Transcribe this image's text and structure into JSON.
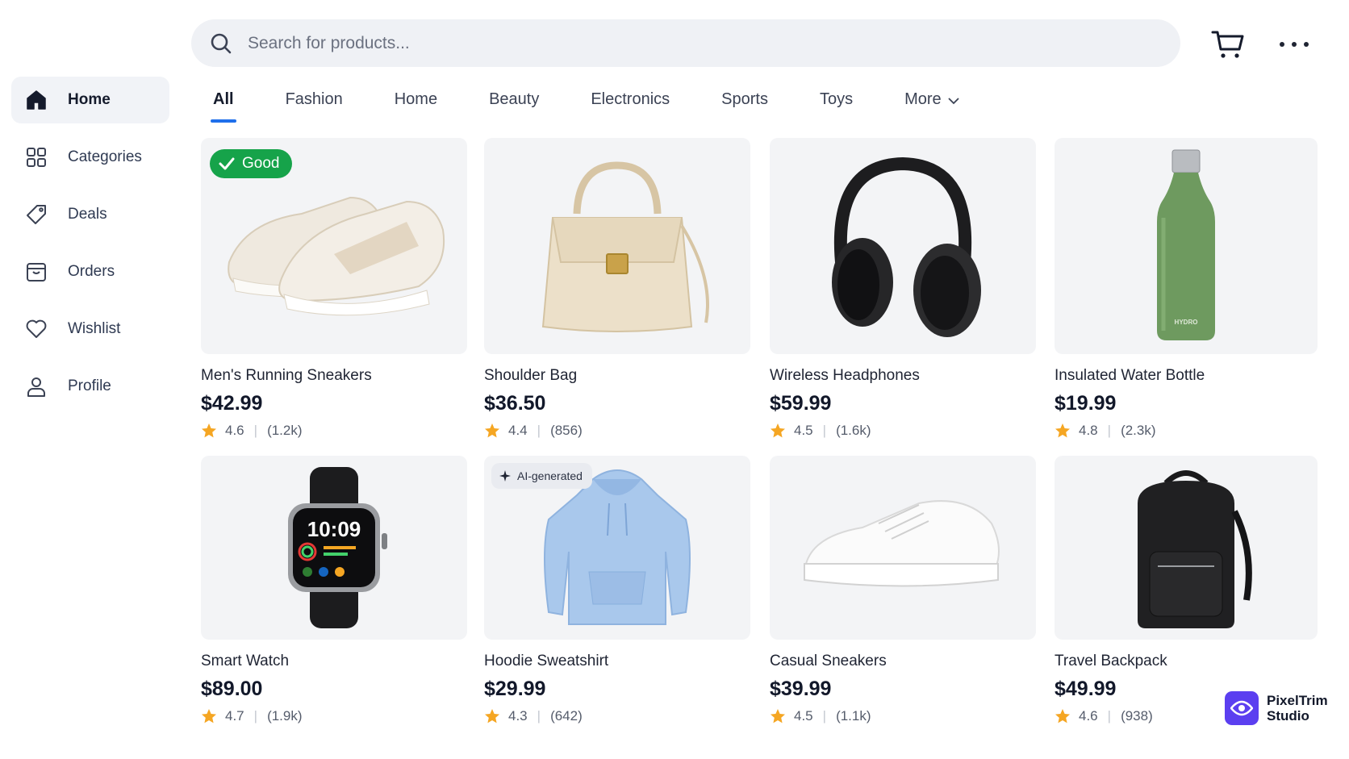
{
  "search": {
    "placeholder": "Search for products..."
  },
  "header": {
    "cart_icon": "cart-icon",
    "more_icon": "more-dots-icon"
  },
  "sidebar": {
    "items": [
      {
        "label": "Home",
        "icon": "home-icon",
        "active": true
      },
      {
        "label": "Categories",
        "icon": "grid-icon"
      },
      {
        "label": "Deals",
        "icon": "tag-icon"
      },
      {
        "label": "Orders",
        "icon": "box-icon"
      },
      {
        "label": "Wishlist",
        "icon": "heart-icon"
      },
      {
        "label": "Profile",
        "icon": "user-icon"
      }
    ]
  },
  "tabs": [
    "All",
    "Fashion",
    "Home",
    "Beauty",
    "Electronics",
    "Sports",
    "Toys",
    "More"
  ],
  "products": [
    {
      "name": "Men's Running Sneakers",
      "price": "$42.99",
      "rating": "4.6",
      "reviews": "(1.2k)",
      "badge": "Good"
    },
    {
      "name": "Shoulder Bag",
      "price": "$36.50",
      "rating": "4.4",
      "reviews": "(856)"
    },
    {
      "name": "Wireless Headphones",
      "price": "$59.99",
      "rating": "4.5",
      "reviews": "(1.6k)"
    },
    {
      "name": "Insulated Water Bottle",
      "price": "$19.99",
      "rating": "4.8",
      "reviews": "(2.3k)",
      "bottle_label": "HYDRO"
    },
    {
      "name": "Smart Watch",
      "price": "$89.00",
      "rating": "4.7",
      "reviews": "(1.9k)",
      "watch_time": "10:09"
    },
    {
      "name": "Hoodie Sweatshirt",
      "price": "$29.99",
      "rating": "4.3",
      "reviews": "(642)",
      "badge": "AI-generated"
    },
    {
      "name": "Casual Sneakers",
      "price": "$39.99",
      "rating": "4.5",
      "reviews": "(1.1k)"
    },
    {
      "name": "Travel Backpack",
      "price": "$49.99",
      "rating": "4.6",
      "reviews": "(938)"
    }
  ],
  "brand": {
    "line1": "PixelTrim",
    "line2": "Studio"
  },
  "colors": {
    "accent": "#1f6feb",
    "good_badge": "#16a34a",
    "star": "#f5a623",
    "brand": "#5b3ff0"
  }
}
